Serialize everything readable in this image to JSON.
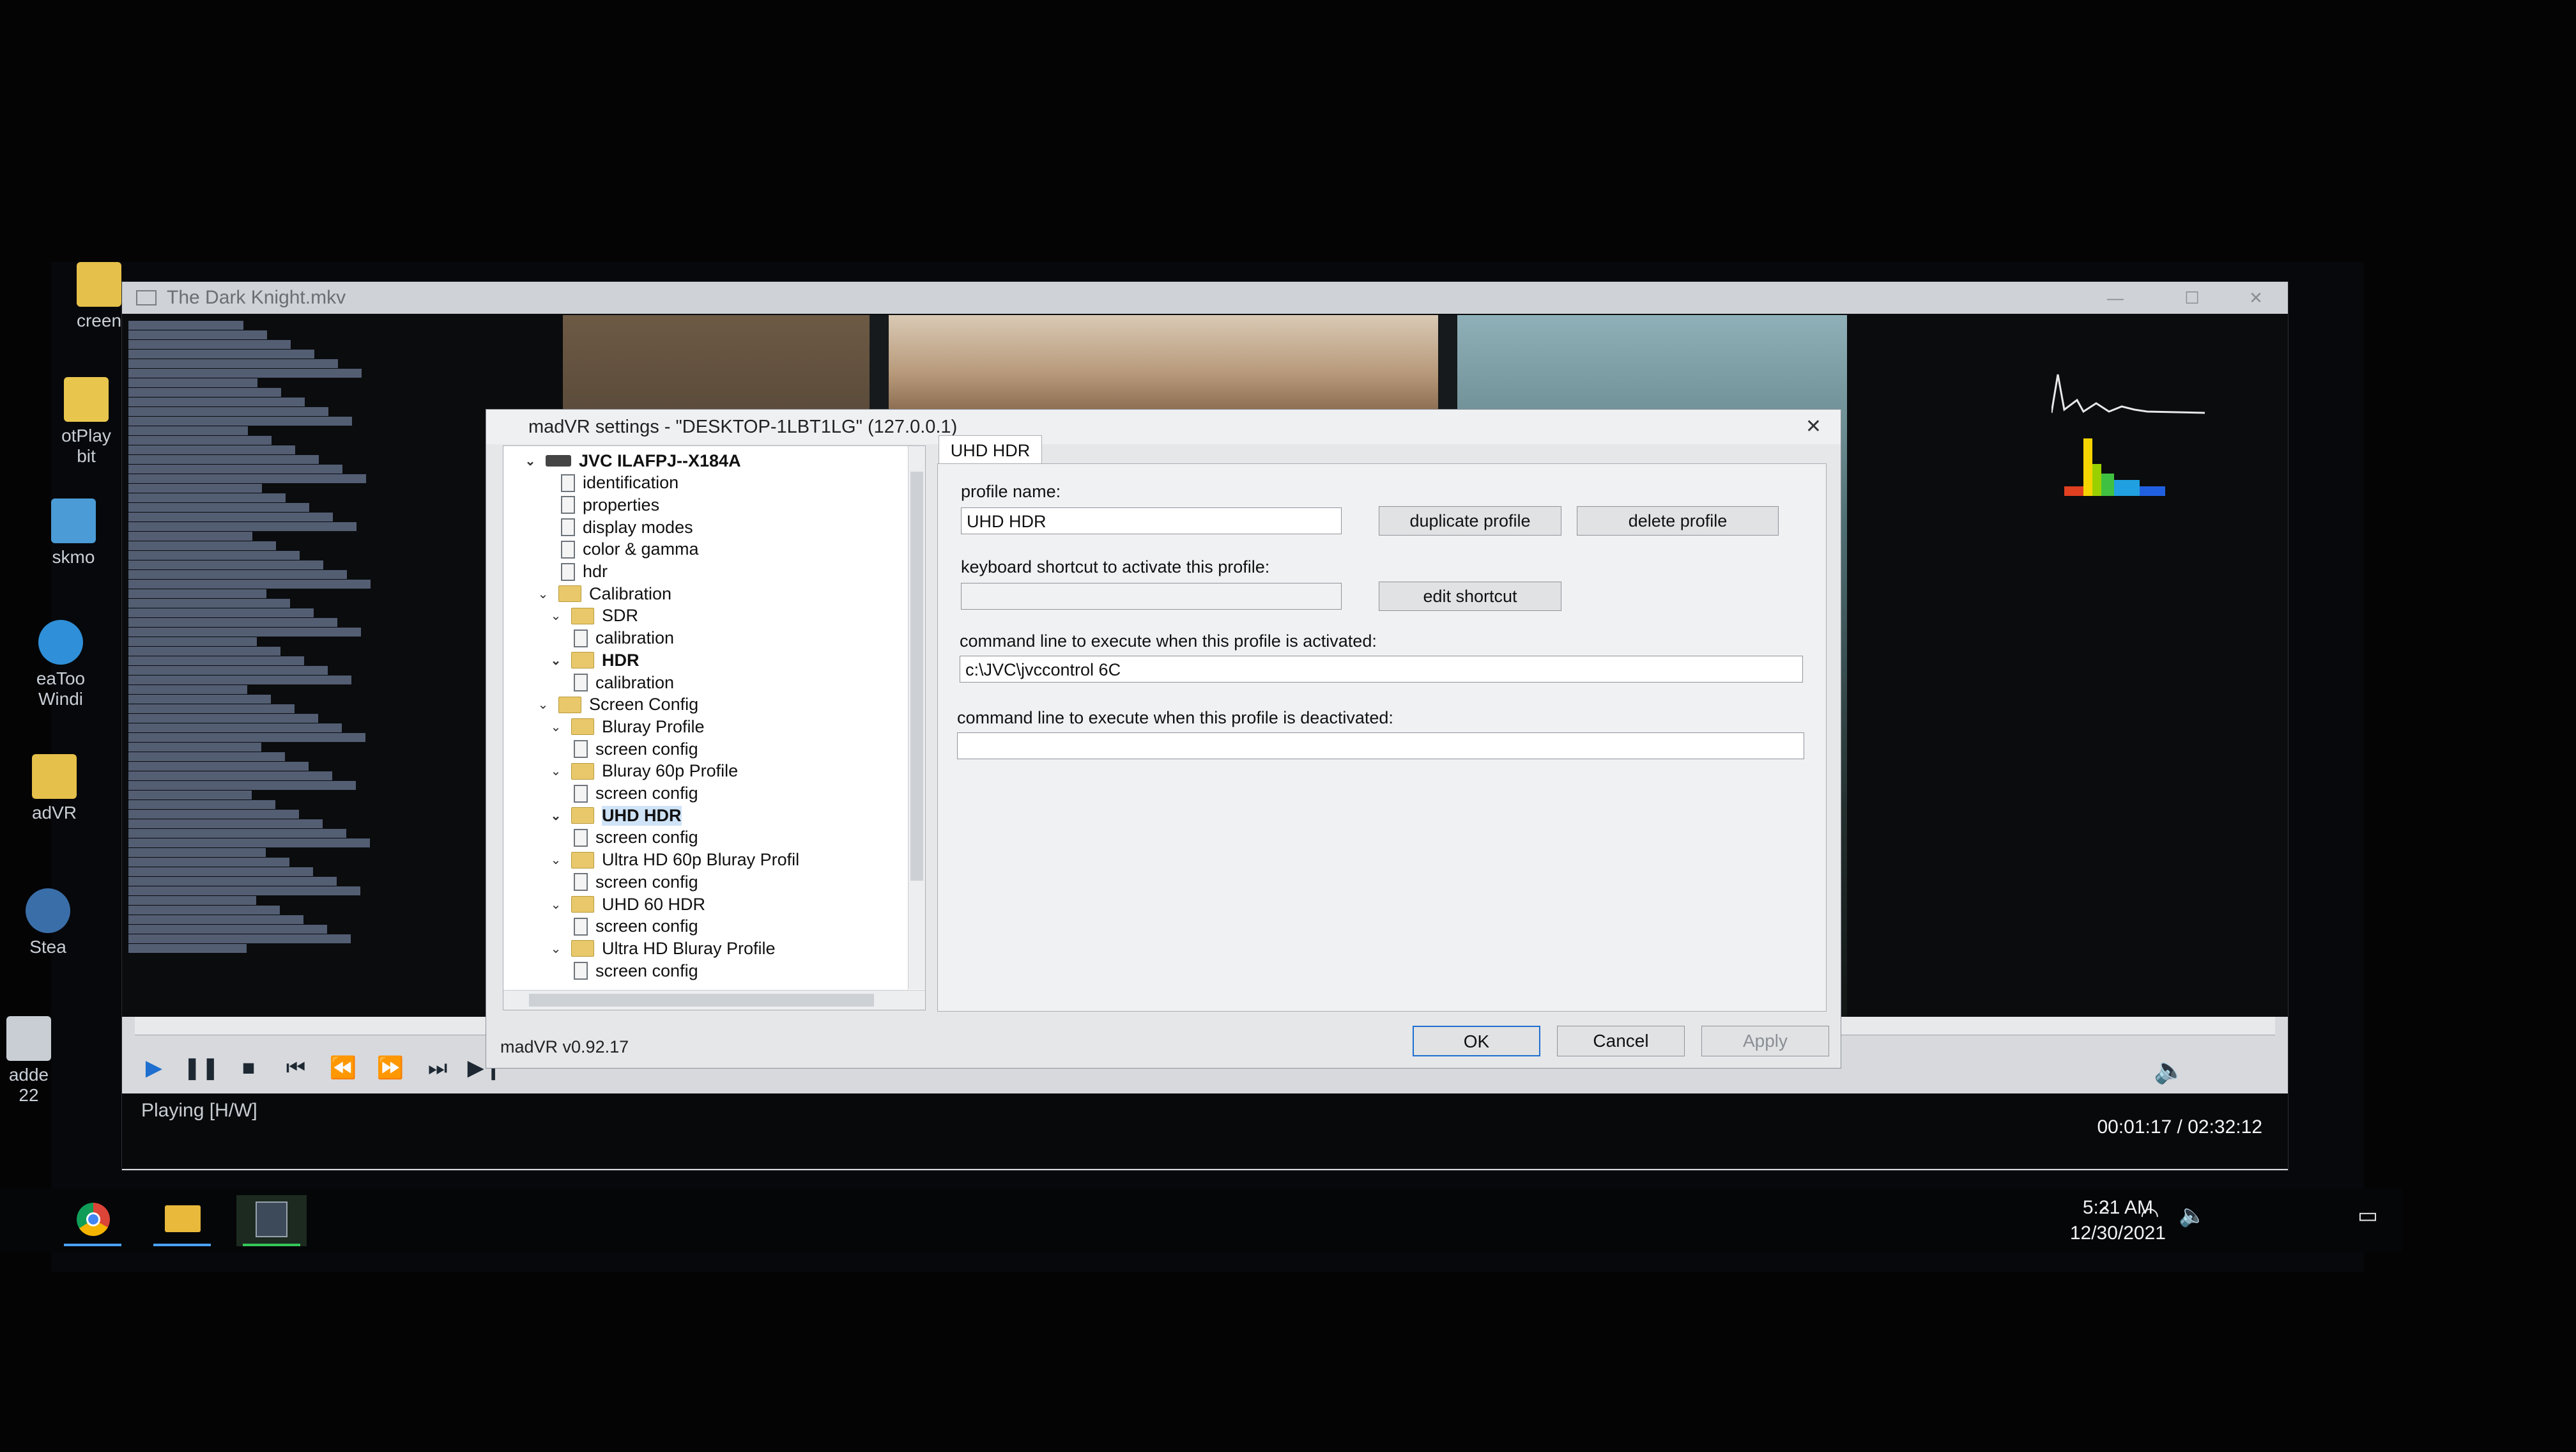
{
  "desktop": {
    "icons": [
      {
        "label": "creen"
      },
      {
        "label": "otPlay\nbit"
      },
      {
        "label": "skmo"
      },
      {
        "label": "eaToo\nWindi"
      },
      {
        "label": "adVR"
      },
      {
        "label": "Stea"
      },
      {
        "label": "adde\n22"
      }
    ]
  },
  "player": {
    "title": "The Dark Knight.mkv",
    "status_left": "Playing [H/W]",
    "time": "00:01:17 / 02:32:12"
  },
  "dialog": {
    "title": "madVR settings - \"DESKTOP-1LBT1LG\" (127.0.0.1)",
    "version": "madVR v0.92.17",
    "tree": [
      {
        "label": "JVC ILAFPJ--X184A",
        "kind": "device",
        "bold": true
      },
      {
        "label": "identification",
        "kind": "page"
      },
      {
        "label": "properties",
        "kind": "page"
      },
      {
        "label": "display modes",
        "kind": "page"
      },
      {
        "label": "color & gamma",
        "kind": "page"
      },
      {
        "label": "hdr",
        "kind": "page"
      },
      {
        "label": "Calibration",
        "kind": "folder"
      },
      {
        "label": "SDR",
        "kind": "folder"
      },
      {
        "label": "calibration",
        "kind": "page"
      },
      {
        "label": "HDR",
        "kind": "folder",
        "bold": true
      },
      {
        "label": "calibration",
        "kind": "page"
      },
      {
        "label": "Screen Config",
        "kind": "folder"
      },
      {
        "label": "Bluray Profile",
        "kind": "folder"
      },
      {
        "label": "screen config",
        "kind": "page"
      },
      {
        "label": "Bluray 60p Profile",
        "kind": "folder"
      },
      {
        "label": "screen config",
        "kind": "page"
      },
      {
        "label": "UHD HDR",
        "kind": "folder",
        "bold": true,
        "selected": true
      },
      {
        "label": "screen config",
        "kind": "page"
      },
      {
        "label": "Ultra HD 60p Bluray Profil",
        "kind": "folder"
      },
      {
        "label": "screen config",
        "kind": "page"
      },
      {
        "label": "UHD 60 HDR",
        "kind": "folder"
      },
      {
        "label": "screen config",
        "kind": "page"
      },
      {
        "label": "Ultra HD Bluray Profile",
        "kind": "folder"
      },
      {
        "label": "screen config",
        "kind": "page"
      }
    ],
    "tab_label": "UHD HDR",
    "profile_name_label": "profile name:",
    "profile_name_value": "UHD HDR",
    "duplicate_label": "duplicate profile",
    "delete_label": "delete profile",
    "shortcut_label": "keyboard shortcut to activate this profile:",
    "shortcut_value": "",
    "edit_shortcut_label": "edit shortcut",
    "activate_label": "command line to execute when this profile is activated:",
    "activate_value": "c:\\JVC\\jvccontrol 6C",
    "deactivate_label": "command line to execute when this profile is deactivated:",
    "deactivate_value": "",
    "ok_label": "OK",
    "cancel_label": "Cancel",
    "apply_label": "Apply"
  },
  "taskbar": {
    "time": "5:21 AM",
    "date": "12/30/2021"
  }
}
